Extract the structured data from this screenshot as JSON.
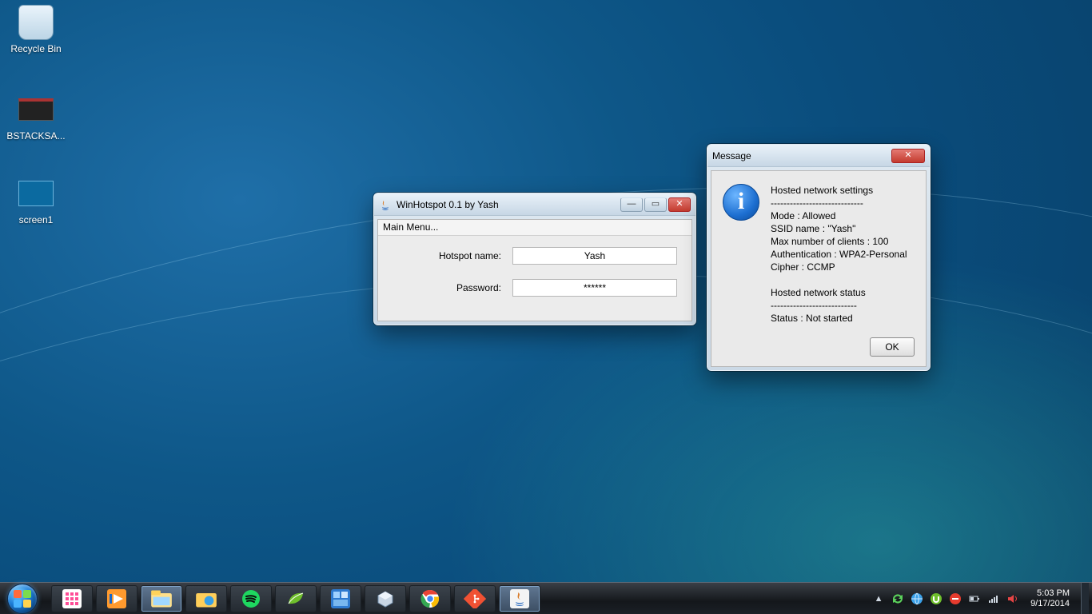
{
  "desktop": {
    "icons": [
      {
        "label": "Recycle Bin"
      },
      {
        "label": "BSTACKSA..."
      },
      {
        "label": "screen1"
      }
    ]
  },
  "hotspot_window": {
    "title": "WinHotspot 0.1 by Yash",
    "menu_label": "Main Menu...",
    "fields": {
      "name_label": "Hotspot name:",
      "name_value": "Yash",
      "password_label": "Password:",
      "password_value": "******"
    }
  },
  "message_window": {
    "title": "Message",
    "heading1": "Hosted network settings",
    "div1": "-----------------------------",
    "mode": "Mode : Allowed",
    "ssid": "SSID name : \"Yash\"",
    "max": "Max number of clients : 100",
    "auth": "Authentication : WPA2-Personal",
    "cipher": "Cipher : CCMP",
    "heading2": "Hosted network status",
    "div2": "---------------------------",
    "status": "Status : Not started",
    "ok_label": "OK"
  },
  "taskbar": {
    "time": "5:03 PM",
    "date": "9/17/2014"
  }
}
